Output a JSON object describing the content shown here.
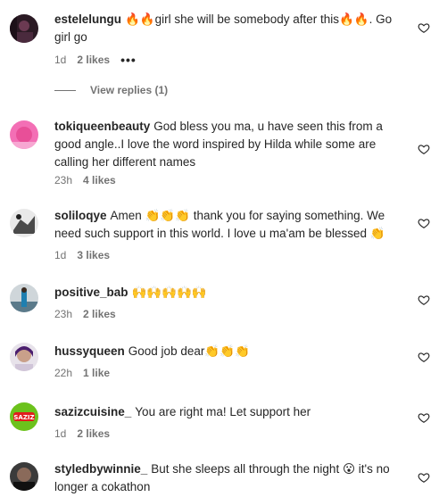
{
  "comments": [
    {
      "user": "estelelungu",
      "emoji_pre": "🔥🔥",
      "text": "girl she will be somebody after this",
      "emoji_mid": "🔥🔥",
      "text2": ". Go girl go",
      "time": "1d",
      "likes": "2 likes",
      "more": "•••",
      "view_replies": "View replies (1)"
    },
    {
      "user": "tokiqueenbeauty",
      "text": "God bless you ma, u have seen this from a good angle..I love the word inspired by Hilda while some are calling her different names",
      "time": "23h",
      "likes": "4 likes"
    },
    {
      "user": "soliloqye",
      "text": "Amen",
      "emoji1": "👏👏👏",
      "text2": " thank you for saying something. We need such support in this world. I love u ma'am be blessed ",
      "emoji2": "👏",
      "time": "1d",
      "likes": "3 likes"
    },
    {
      "user": "positive_bab",
      "emoji": "🙌🙌🙌🙌🙌",
      "time": "23h",
      "likes": "2 likes"
    },
    {
      "user": "hussyqueen",
      "text": "Good job dear",
      "emoji": "👏👏👏",
      "time": "22h",
      "likes": "1 like"
    },
    {
      "user": "sazizcuisine_",
      "text": "You are right ma! Let support her",
      "time": "1d",
      "likes": "2 likes"
    },
    {
      "user": "styledbywinnie_",
      "text": "But she sleeps all through the night ",
      "emoji": "😮",
      "text2": " it's no longer a cokathon"
    }
  ],
  "avatar_badges": {
    "sazizcuisine": "SAZIZ"
  },
  "icons": {
    "like": "heart-outline-icon",
    "more": "more-dots-icon"
  }
}
